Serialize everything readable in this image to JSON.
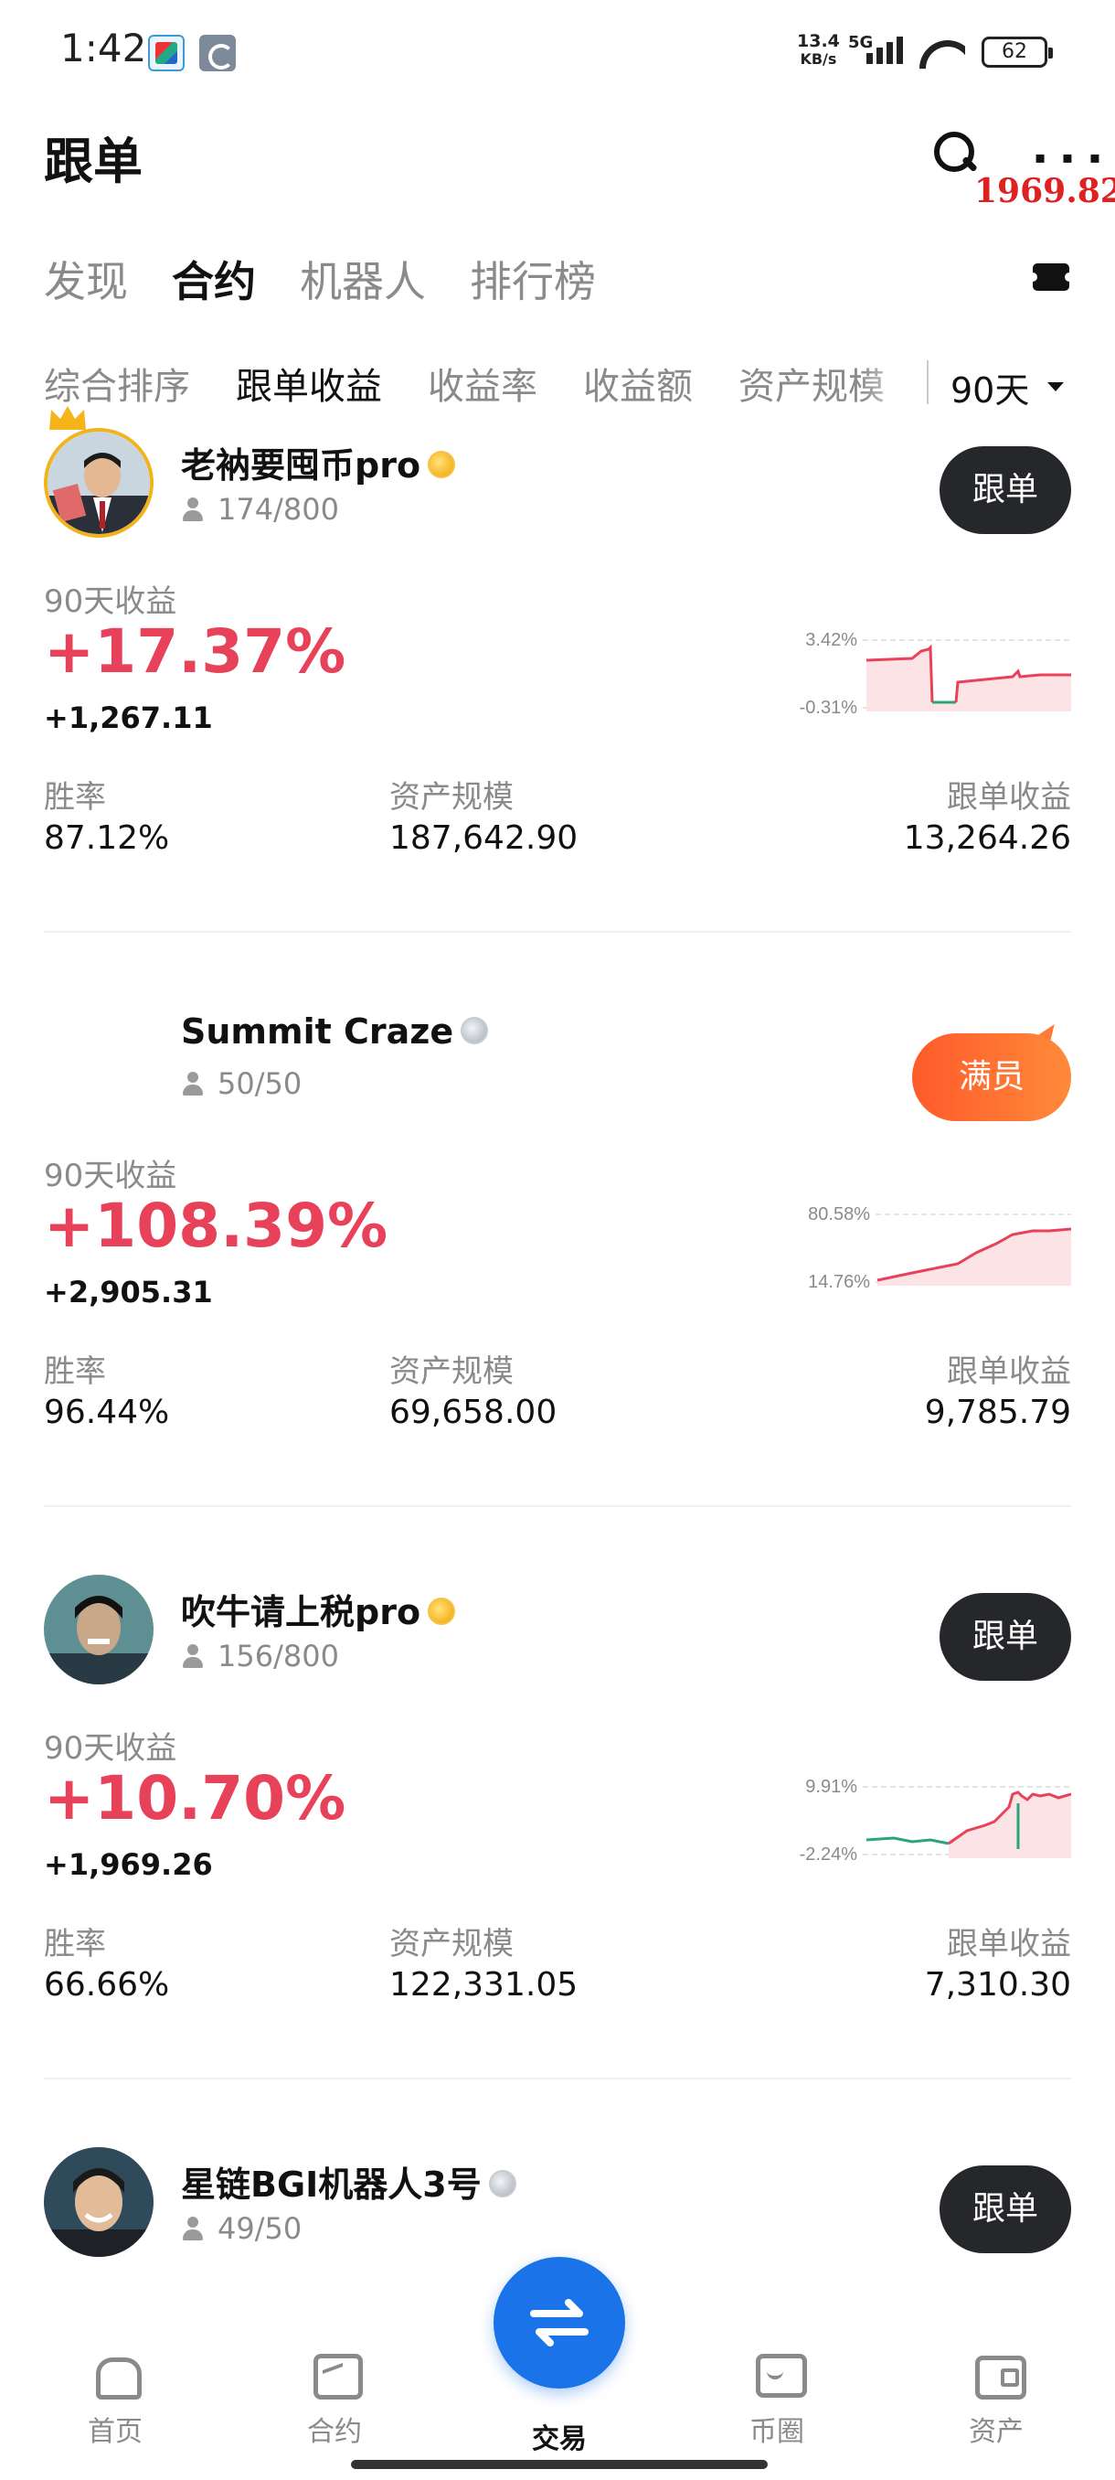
{
  "status_bar": {
    "time": "1:42",
    "net_speed_top": "13.4",
    "net_speed_unit": "KB/s",
    "network": "5G",
    "battery": "62"
  },
  "header": {
    "title": "跟单",
    "dots": "▪ ▪ ▪",
    "price_overlay": "1969.82"
  },
  "main_tabs": [
    "发现",
    "合约",
    "机器人",
    "排行榜"
  ],
  "main_tab_active": 1,
  "sort_tabs": [
    "综合排序",
    "跟单收益",
    "收益率",
    "收益额",
    "资产规模"
  ],
  "sort_tab_active": 1,
  "period_selector": "90天",
  "labels": {
    "period_return": "90天收益",
    "win_rate": "胜率",
    "aum": "资产规模",
    "copy_profit": "跟单收益"
  },
  "traders": [
    {
      "name": "老衲要囤币pro",
      "badge": "gold",
      "followers": "174/800",
      "button": "跟单",
      "return_pct": "+17.37%",
      "return_abs": "+1,267.11",
      "win_rate": "87.12%",
      "aum": "187,642.90",
      "copy_profit": "13,264.26",
      "chart_max_label": "3.42%",
      "chart_min_label": "-0.31%"
    },
    {
      "name": "Summit Craze",
      "badge": "silver",
      "followers": "50/50",
      "button": "满员",
      "return_pct": "+108.39%",
      "return_abs": "+2,905.31",
      "win_rate": "96.44%",
      "aum": "69,658.00",
      "copy_profit": "9,785.79",
      "chart_max_label": "80.58%",
      "chart_min_label": "14.76%"
    },
    {
      "name": "吹牛请上税pro",
      "badge": "gold",
      "followers": "156/800",
      "button": "跟单",
      "return_pct": "+10.70%",
      "return_abs": "+1,969.26",
      "win_rate": "66.66%",
      "aum": "122,331.05",
      "copy_profit": "7,310.30",
      "chart_max_label": "9.91%",
      "chart_min_label": "-2.24%"
    },
    {
      "name": "星链BGI机器人3号",
      "badge": "silver",
      "followers": "49/50",
      "button": "跟单"
    }
  ],
  "bottom_nav": [
    "首页",
    "合约",
    "交易",
    "币圈",
    "资产"
  ],
  "colors": {
    "positive": "#e8425a",
    "negative_line": "#2aa57a",
    "accent_blue": "#1a73e8",
    "dark_button": "#25272b",
    "full_button": "#ff6a30"
  }
}
